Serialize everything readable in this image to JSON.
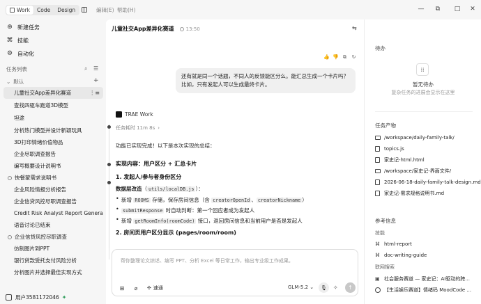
{
  "titlebar": {
    "tabs": [
      {
        "label": "Work",
        "active": true
      },
      {
        "label": "Code",
        "active": false
      },
      {
        "label": "Design",
        "active": false
      }
    ],
    "menu": [
      "编辑(E)",
      "帮助(H)"
    ]
  },
  "sidebar": {
    "nav": [
      {
        "label": "新建任务",
        "icon": "new-task-icon"
      },
      {
        "label": "技能",
        "icon": "skills-icon"
      },
      {
        "label": "自动化",
        "icon": "automation-icon"
      }
    ],
    "section_label": "任务列表",
    "group_label": "默认",
    "tasks": [
      {
        "label": "儿童社交App差异化赛道",
        "selected": true
      },
      {
        "label": "查找四驱车跑道3D模型"
      },
      {
        "label": "坦途"
      },
      {
        "label": "分析热门模型并设计新颖玩具"
      },
      {
        "label": "3D打印情绪价值物品"
      },
      {
        "label": "企业尽职调查报告"
      },
      {
        "label": "编写概要设计说明书"
      }
    ],
    "group2_label": "快餐蒙需求说明书",
    "tasks2": [
      {
        "label": "企业风险情报分析报告"
      },
      {
        "label": "企业信贷风控尽职调查报告"
      },
      {
        "label": "Credit Risk Analyst Report Generation"
      },
      {
        "label": "语音讨论已结束"
      }
    ],
    "group3_label": "企业信贷风控尽职调查",
    "tasks3": [
      {
        "label": "仿制图片到PPT"
      },
      {
        "label": "银行贷款受托支付风险分析"
      },
      {
        "label": "分析图片并选择最佳实现方式"
      }
    ],
    "user": {
      "name": "用户3581172046",
      "badge": "green-leaf-icon"
    }
  },
  "main": {
    "title": "儿童社交App差异化赛道",
    "time": "13:50",
    "user_message": "还有就是同一个话题，不同人的反馈能区分么。能汇总生成一个卡片吗？比如，只有发起人可以生成最终卡片。",
    "agent_name": "TRAE Work",
    "elapsed": "任务耗时 11m 8s",
    "intro": "功能已实现完成！以下是本次实现的总结：",
    "h_core": "实现内容：用户区分 + 汇总卡片",
    "h1": "1. 发起人/参与者身份区分",
    "layer_label": "数据层改造",
    "layer_file": "utils/localDB.js",
    "bullets": [
      {
        "pre": "新增 ",
        "code1": "ROOMS",
        "mid": " 存储，保存房间信息（含 ",
        "code2": "creatorOpenId",
        "sep": "、",
        "code3": "creatorNickname",
        "post": "）"
      },
      {
        "code1": "submitResponse",
        "post": " 时自动判断：第一个回应者成为发起人"
      },
      {
        "pre": "新增 ",
        "code1": "getRoomInfo(roomCode)",
        "post": " 接口，返回房间信息和当前用户是否是发起人"
      }
    ],
    "h2_prefix": "2. 房间页用户区分显示 (",
    "h2_path": "pages/room/room",
    "h2_suffix": ")",
    "composer_placeholder": "帮你整理论文综述、编写 PPT、分析 Excel 等日常工作，输出专业级工作成果。",
    "speed_label": "速通",
    "model_label": "GLM-5.2"
  },
  "right": {
    "todo_title": "待办",
    "todo_empty": "暂无待办",
    "todo_hint": "复杂任务的进展会显示在这里",
    "artifacts_title": "任务产物",
    "artifacts": [
      {
        "label": "/workspace/daily-family-talk/",
        "type": "folder"
      },
      {
        "label": "topics.js",
        "type": "file"
      },
      {
        "label": "家史记-html.html",
        "type": "file"
      },
      {
        "label": "/workspace/家史记-界面文件/",
        "type": "folder"
      },
      {
        "label": "2026-06-18-daily-family-talk-design.md",
        "type": "file"
      },
      {
        "label": "家史记-需求规格说明书.md",
        "type": "file"
      }
    ],
    "ref_title": "参考信息",
    "skills_title": "技能",
    "skills": [
      "html-report",
      "doc-writing-guide"
    ],
    "search_title": "联网搜索",
    "searches": [
      "社会服务赛道 — 家史记：AI驱动的跨...",
      "【生活娱乐赛道】情绪码 MoodCode ..."
    ]
  },
  "colors": {
    "accent": "#2e9b5a",
    "selected_bg": "#e8e8e8",
    "bubble_bg": "#f0f0f0"
  }
}
